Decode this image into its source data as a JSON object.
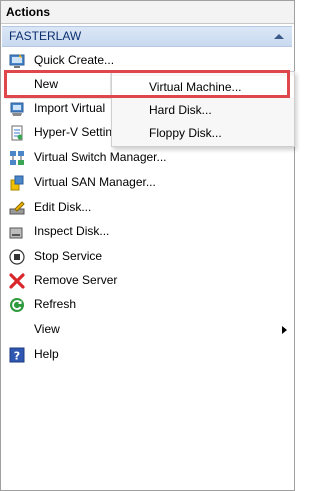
{
  "pane": {
    "title": "Actions"
  },
  "group": {
    "name": "FASTERLAW"
  },
  "items": [
    {
      "label": "Quick Create...",
      "icon": "quick-create-icon"
    },
    {
      "label": "New",
      "icon": "new-icon",
      "submenu": true
    },
    {
      "label": "Import Virtual",
      "icon": "import-vm-icon"
    },
    {
      "label": "Hyper-V Settin",
      "icon": "hyperv-settings-icon"
    },
    {
      "label": "Virtual Switch Manager...",
      "icon": "virtual-switch-icon"
    },
    {
      "label": "Virtual SAN Manager...",
      "icon": "virtual-san-icon"
    },
    {
      "label": "Edit Disk...",
      "icon": "edit-disk-icon"
    },
    {
      "label": "Inspect Disk...",
      "icon": "inspect-disk-icon"
    },
    {
      "label": "Stop Service",
      "icon": "stop-service-icon"
    },
    {
      "label": "Remove Server",
      "icon": "remove-server-icon"
    },
    {
      "label": "Refresh",
      "icon": "refresh-icon"
    },
    {
      "label": "View",
      "icon": "",
      "submenu": true
    },
    {
      "label": "Help",
      "icon": "help-icon"
    }
  ],
  "new_menu": {
    "items": [
      {
        "label": "Virtual Machine..."
      },
      {
        "label": "Hard Disk..."
      },
      {
        "label": "Floppy Disk..."
      }
    ],
    "highlighted": "Virtual Machine..."
  },
  "colors": {
    "highlight_box": "#e0474c",
    "group_header_text": "#0c2f6e"
  }
}
